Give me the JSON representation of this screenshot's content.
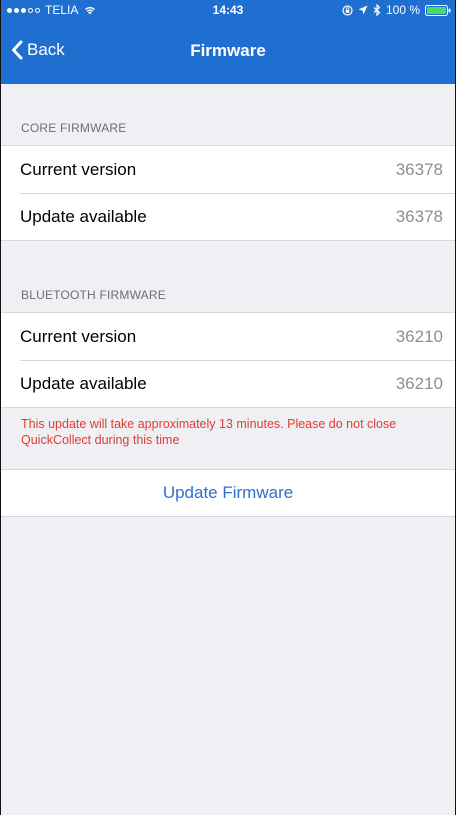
{
  "status_bar": {
    "carrier": "TELIA",
    "time": "14:43",
    "battery": "100 %",
    "icons": [
      "signal-dots-icon",
      "wifi-icon",
      "lock-rotation-icon",
      "location-arrow-icon",
      "bluetooth-icon",
      "battery-icon"
    ]
  },
  "nav": {
    "back_label": "Back",
    "title": "Firmware"
  },
  "core": {
    "header": "CORE FIRMWARE",
    "rows": [
      {
        "label": "Current version",
        "value": "36378"
      },
      {
        "label": "Update available",
        "value": "36378"
      }
    ]
  },
  "bluetooth": {
    "header": "BLUETOOTH FIRMWARE",
    "rows": [
      {
        "label": "Current version",
        "value": "36210"
      },
      {
        "label": "Update available",
        "value": "36210"
      }
    ]
  },
  "warning": "This update will take approximately 13 minutes. Please do not close QuickCollect during this time",
  "action": {
    "label": "Update Firmware"
  },
  "colors": {
    "nav_blue": "#1f6fd1",
    "warning_red": "#e23c2f",
    "link_blue": "#2d6fd0",
    "background": "#efeff4"
  }
}
